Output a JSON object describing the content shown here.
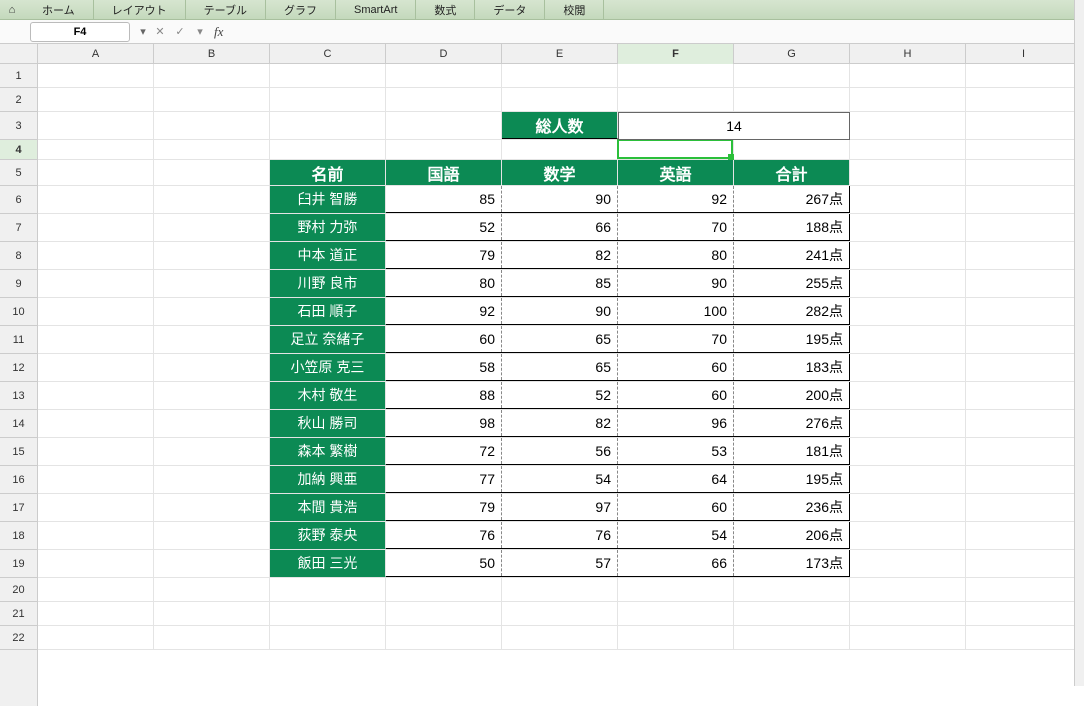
{
  "ribbon": {
    "tabs": [
      "ホーム",
      "レイアウト",
      "テーブル",
      "グラフ",
      "SmartArt",
      "数式",
      "データ",
      "校閲"
    ]
  },
  "namebox": "F4",
  "formula": "",
  "columns": [
    "A",
    "B",
    "C",
    "D",
    "E",
    "F",
    "G",
    "H",
    "I"
  ],
  "rowcount": 22,
  "active": {
    "col": "F",
    "row": 4
  },
  "summary": {
    "label": "総人数",
    "value": "14"
  },
  "table": {
    "headers": [
      "名前",
      "国語",
      "数学",
      "英語",
      "合計"
    ],
    "suffix": "点",
    "rows": [
      {
        "name": "臼井 智勝",
        "s": [
          85,
          90,
          92
        ],
        "t": 267
      },
      {
        "name": "野村 力弥",
        "s": [
          52,
          66,
          70
        ],
        "t": 188
      },
      {
        "name": "中本 道正",
        "s": [
          79,
          82,
          80
        ],
        "t": 241
      },
      {
        "name": "川野 良市",
        "s": [
          80,
          85,
          90
        ],
        "t": 255
      },
      {
        "name": "石田 順子",
        "s": [
          92,
          90,
          100
        ],
        "t": 282
      },
      {
        "name": "足立 奈緒子",
        "s": [
          60,
          65,
          70
        ],
        "t": 195
      },
      {
        "name": "小笠原 克三",
        "s": [
          58,
          65,
          60
        ],
        "t": 183
      },
      {
        "name": "木村 敬生",
        "s": [
          88,
          52,
          60
        ],
        "t": 200
      },
      {
        "name": "秋山 勝司",
        "s": [
          98,
          82,
          96
        ],
        "t": 276
      },
      {
        "name": "森本 繁樹",
        "s": [
          72,
          56,
          53
        ],
        "t": 181
      },
      {
        "name": "加納 興亜",
        "s": [
          77,
          54,
          64
        ],
        "t": 195
      },
      {
        "name": "本間 貴浩",
        "s": [
          79,
          97,
          60
        ],
        "t": 236
      },
      {
        "name": "荻野 泰央",
        "s": [
          76,
          76,
          54
        ],
        "t": 206
      },
      {
        "name": "飯田 三光",
        "s": [
          50,
          57,
          66
        ],
        "t": 173
      }
    ]
  },
  "chart_data": {
    "type": "table",
    "title": "総人数 14",
    "columns": [
      "名前",
      "国語",
      "数学",
      "英語",
      "合計"
    ],
    "rows": [
      [
        "臼井 智勝",
        85,
        90,
        92,
        267
      ],
      [
        "野村 力弥",
        52,
        66,
        70,
        188
      ],
      [
        "中本 道正",
        79,
        82,
        80,
        241
      ],
      [
        "川野 良市",
        80,
        85,
        90,
        255
      ],
      [
        "石田 順子",
        92,
        90,
        100,
        282
      ],
      [
        "足立 奈緒子",
        60,
        65,
        70,
        195
      ],
      [
        "小笠原 克三",
        58,
        65,
        60,
        183
      ],
      [
        "木村 敬生",
        88,
        52,
        60,
        200
      ],
      [
        "秋山 勝司",
        98,
        82,
        96,
        276
      ],
      [
        "森本 繁樹",
        72,
        56,
        53,
        181
      ],
      [
        "加納 興亜",
        77,
        54,
        64,
        195
      ],
      [
        "本間 貴浩",
        79,
        97,
        60,
        236
      ],
      [
        "荻野 泰央",
        76,
        76,
        54,
        206
      ],
      [
        "飯田 三光",
        50,
        57,
        66,
        173
      ]
    ]
  }
}
